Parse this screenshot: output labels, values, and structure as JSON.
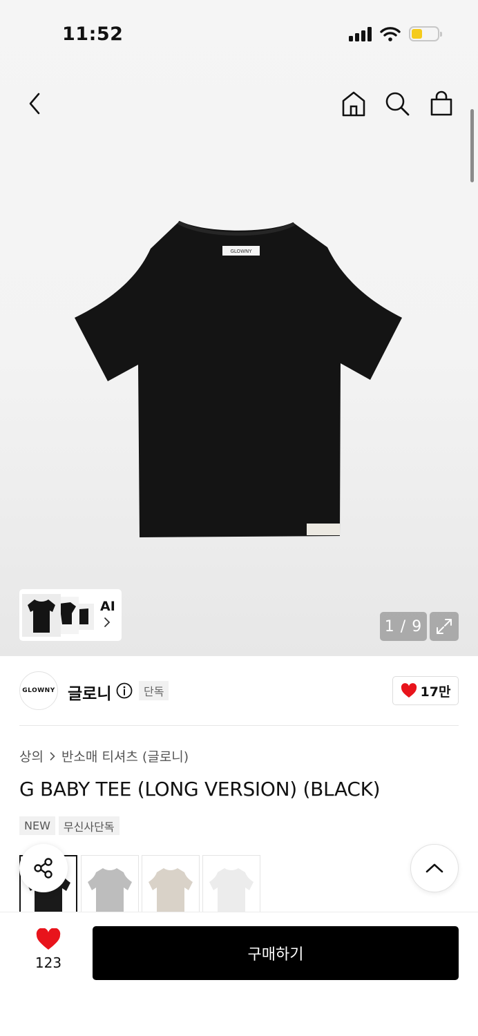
{
  "status_bar": {
    "time": "11:52"
  },
  "header": {
    "back_icon": "chevron-left-icon",
    "home_icon": "home-icon",
    "search_icon": "search-icon",
    "bag_icon": "shopping-bag-icon"
  },
  "gallery": {
    "counter": "1 / 9",
    "ai_label": "AI",
    "product_label": "GLOWNY",
    "expand_icon": "expand-icon"
  },
  "brand": {
    "logo_text": "GLOWNY",
    "name": "글로니",
    "exclusive_badge": "단독",
    "likes": "17만"
  },
  "breadcrumb": {
    "category": "상의",
    "subcategory": "반소매 티셔츠 (글로니)"
  },
  "product": {
    "title": "G BABY TEE (LONG VERSION) (BLACK)",
    "tags": [
      "NEW",
      "무신사단독"
    ]
  },
  "colors": {
    "variants": [
      "#1a1a1a",
      "#bdbdbd",
      "#d9d2c8",
      "#ececec"
    ],
    "accent_red": "#e8141c"
  },
  "bottom_bar": {
    "wish_count": "123",
    "buy_label": "구매하기"
  }
}
